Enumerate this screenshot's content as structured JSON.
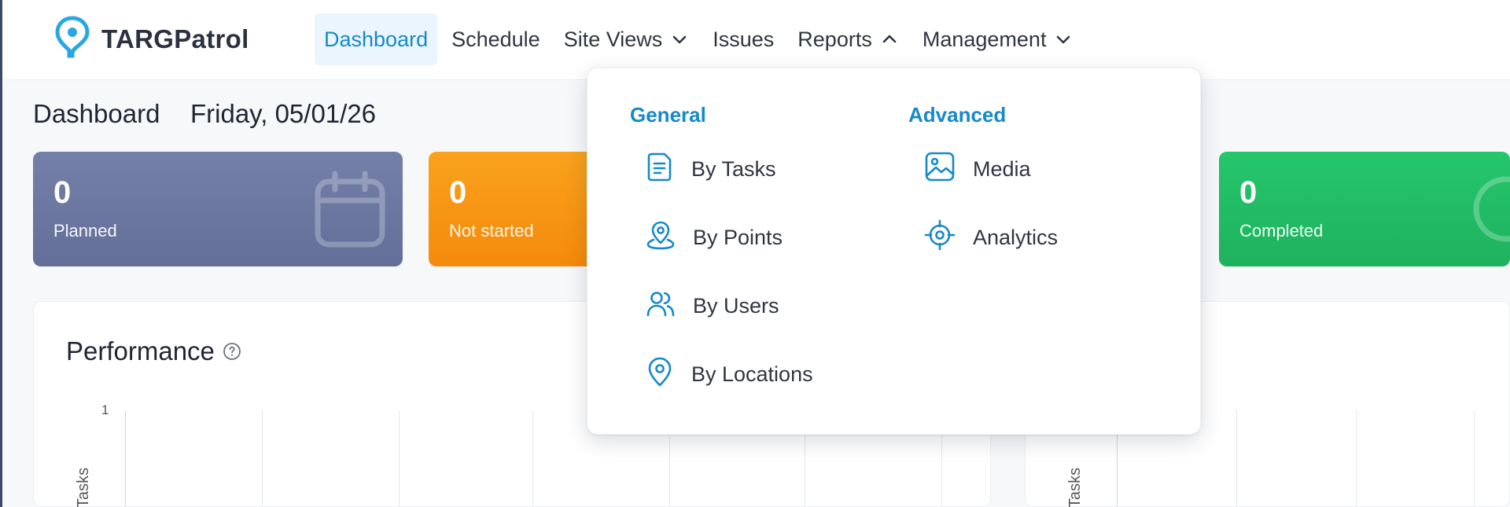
{
  "app": {
    "name": "TARGPatrol",
    "logo_icon": "location-pin-icon"
  },
  "colors": {
    "brand": "#1689c9",
    "planned": "#6b78a2",
    "not_started": "#f7950f",
    "completed": "#22bb65"
  },
  "nav": {
    "items": [
      {
        "label": "Dashboard",
        "active": true
      },
      {
        "label": "Schedule"
      },
      {
        "label": "Site Views",
        "icon": "chevron-down-icon"
      },
      {
        "label": "Issues"
      },
      {
        "label": "Reports",
        "icon": "chevron-up-icon"
      },
      {
        "label": "Management",
        "icon": "chevron-down-icon"
      }
    ]
  },
  "page": {
    "title": "Dashboard",
    "date": "Friday, 05/01/26"
  },
  "stats": [
    {
      "value": "0",
      "label": "Planned",
      "icon": "calendar-icon"
    },
    {
      "value": "0",
      "label": "Not started"
    },
    {
      "value": "0",
      "label": "Completed"
    }
  ],
  "performance": {
    "title": "Performance",
    "icon": "help-icon",
    "y_tick": "1",
    "y_label": "Tasks"
  },
  "right_panel": {
    "y_label": "Tasks"
  },
  "reports_menu": {
    "general": {
      "heading": "General",
      "items": [
        {
          "label": "By Tasks",
          "icon": "document-icon"
        },
        {
          "label": "By Points",
          "icon": "map-pin-icon"
        },
        {
          "label": "By Users",
          "icon": "users-icon"
        },
        {
          "label": "By Locations",
          "icon": "location-icon"
        }
      ]
    },
    "advanced": {
      "heading": "Advanced",
      "items": [
        {
          "label": "Media",
          "icon": "image-icon"
        },
        {
          "label": "Analytics",
          "icon": "target-icon"
        }
      ]
    }
  }
}
